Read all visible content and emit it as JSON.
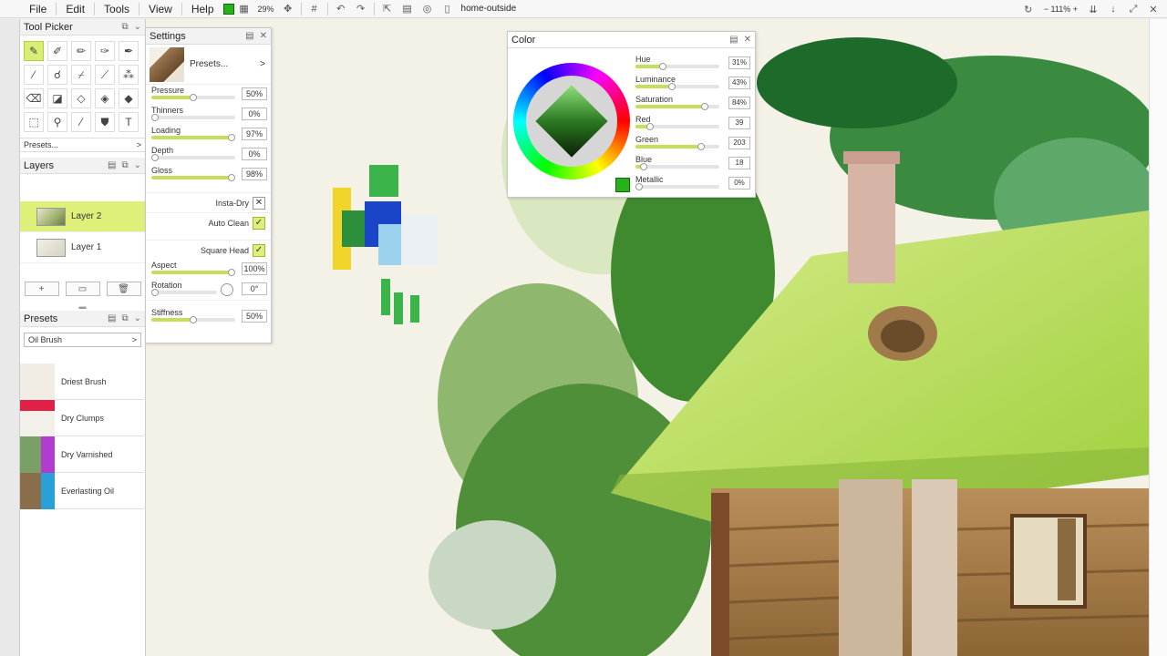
{
  "menu": [
    "File",
    "Edit",
    "Tools",
    "View",
    "Help"
  ],
  "toolbar": {
    "zoom": "29%",
    "document_name": "home-outside",
    "zoom_percent": "111%",
    "active_color": "#27b21c"
  },
  "tool_picker": {
    "title": "Tool Picker",
    "tools": [
      "pen-icon",
      "brush-icon",
      "pencil-icon",
      "airbrush-icon",
      "marker-icon",
      "knife-icon",
      "smudge-icon",
      "nib-icon",
      "ink-icon",
      "spray-icon",
      "eraser-icon",
      "tape-icon",
      "fill-icon",
      "blender-icon",
      "water-icon",
      "select-icon",
      "lasso-icon",
      "dropper-icon",
      "bucket-icon",
      "text-icon"
    ],
    "presets_label": "Presets..."
  },
  "layers": {
    "title": "Layers",
    "items": [
      {
        "name": "Layer 2",
        "active": true
      },
      {
        "name": "Layer 1",
        "active": false
      }
    ]
  },
  "presets_panel": {
    "title": "Presets",
    "selected": "Oil Brush",
    "items": [
      "Driest Brush",
      "Dry Clumps",
      "Dry Varnished",
      "Everlasting Oil"
    ]
  },
  "settings": {
    "title": "Settings",
    "presets_label": "Presets...",
    "sliders": [
      {
        "label": "Pressure",
        "value": "50%",
        "level": 0.5
      },
      {
        "label": "Thinners",
        "value": "0%",
        "level": 0.0
      },
      {
        "label": "Loading",
        "value": "97%",
        "level": 0.97
      },
      {
        "label": "Depth",
        "value": "0%",
        "level": 0.0
      },
      {
        "label": "Gloss",
        "value": "98%",
        "level": 0.98
      }
    ],
    "insta_dry": "Insta-Dry",
    "auto_clean": "Auto Clean",
    "square_head": "Square Head",
    "sliders2": [
      {
        "label": "Aspect",
        "value": "100%",
        "level": 1.0
      },
      {
        "label": "Rotation",
        "value": "0°",
        "level": 0.0
      }
    ],
    "stiffness": {
      "label": "Stiffness",
      "value": "50%",
      "level": 0.5
    }
  },
  "color_panel": {
    "title": "Color",
    "sliders": [
      {
        "label": "Hue",
        "value": "31%",
        "level": 0.31
      },
      {
        "label": "Luminance",
        "value": "43%",
        "level": 0.43
      },
      {
        "label": "Saturation",
        "value": "84%",
        "level": 0.84
      },
      {
        "label": "Red",
        "value": "39",
        "level": 0.15
      },
      {
        "label": "Green",
        "value": "203",
        "level": 0.8
      },
      {
        "label": "Blue",
        "value": "18",
        "level": 0.07
      },
      {
        "label": "Metallic",
        "value": "0%",
        "level": 0.0
      }
    ]
  }
}
